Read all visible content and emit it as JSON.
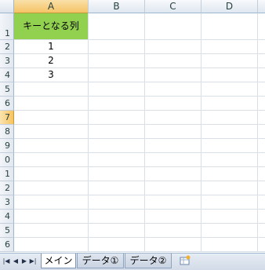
{
  "columns": [
    "A",
    "B",
    "C",
    "D"
  ],
  "selected_column": "A",
  "rows": [
    "1",
    "2",
    "3",
    "4",
    "5",
    "6",
    "7",
    "8",
    "9",
    "0",
    "1",
    "2",
    "3",
    "4",
    "5",
    "6"
  ],
  "selected_row_index": 6,
  "cells": {
    "A1": "キーとなる列",
    "A2": "1",
    "A3": "2",
    "A4": "3"
  },
  "header_cell_color": "#92d050",
  "sheet_tabs": [
    {
      "label": "メイン",
      "active": true
    },
    {
      "label": "データ①",
      "active": false
    },
    {
      "label": "データ②",
      "active": false
    }
  ],
  "nav_buttons": [
    "first-sheet-icon",
    "prev-sheet-icon",
    "next-sheet-icon",
    "last-sheet-icon"
  ],
  "new_sheet_icon": "insert-worksheet-icon"
}
